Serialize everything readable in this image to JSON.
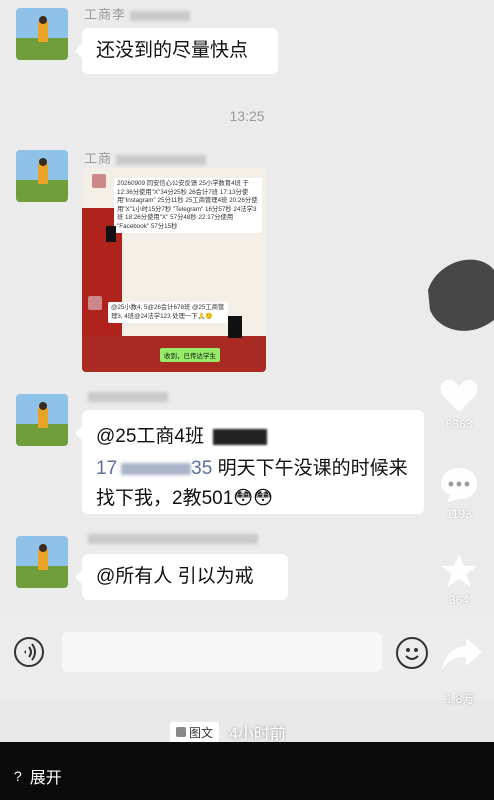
{
  "chat": {
    "msg1": {
      "sender": "工商李",
      "text": "还没到的尽量快点"
    },
    "timestamp": "13:25",
    "msg2": {
      "sender": "工商",
      "image": {
        "text1": "20260909 同安信心公安反馈 25小学数育4班 于 12:36分使用\"X\"34分25秒 26会计7班 17:13分使用\"Instagram\" 25分11秒 25工商管理4班 20:26分使用\"X\"1小时15分7秒 \"Telegram\" 16分57秒 24法学3班 18:26分使用\"X\" 57分48秒 22:17分使用 \"Facebook\" 57分15秒",
        "text2": "@25小数4, 5@26会计678班 @25工商管理3, 4班@24法学123 处理一下🙏🙂",
        "reply": "收到，已传达学生"
      }
    },
    "msg3": {
      "mention": "@25工商4班",
      "num_prefix": "17",
      "num_suffix": "35",
      "text": "明天下午没课的时候来找下我，2教501😳😳"
    },
    "msg4": {
      "text": "@所有人 引以为戒"
    }
  },
  "side": {
    "like_count": "6363",
    "comment_count": "1193",
    "star_count": "364",
    "share_count": "1.8万"
  },
  "meta": {
    "tag": "图文",
    "time": "4小时前"
  },
  "bottom": {
    "expand": "展开"
  },
  "colors": {
    "bubble": "#ffffff",
    "chat_bg": "#ebebeb",
    "reply_green": "#95ec69",
    "bottom_bar": "#0b0b0b"
  }
}
